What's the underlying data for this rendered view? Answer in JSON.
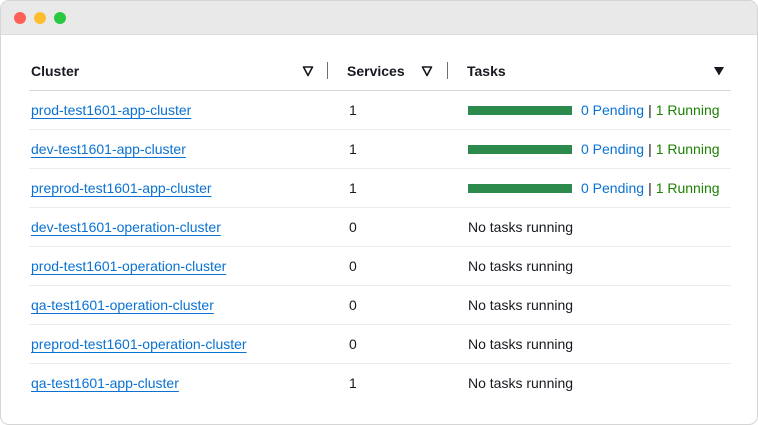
{
  "table": {
    "headers": {
      "cluster": "Cluster",
      "services": "Services",
      "tasks": "Tasks"
    },
    "sort_icons": {
      "cluster": "filter-triangle-outline-icon",
      "services": "filter-triangle-outline-icon",
      "tasks": "caret-down-filled-icon"
    },
    "rows": [
      {
        "cluster": "prod-test1601-app-cluster",
        "services": "1",
        "bar": true,
        "pending": "0 Pending",
        "sep": "|",
        "running": "1 Running",
        "no_tasks": ""
      },
      {
        "cluster": "dev-test1601-app-cluster",
        "services": "1",
        "bar": true,
        "pending": "0 Pending",
        "sep": "|",
        "running": "1 Running",
        "no_tasks": ""
      },
      {
        "cluster": "preprod-test1601-app-cluster",
        "services": "1",
        "bar": true,
        "pending": "0 Pending",
        "sep": "|",
        "running": "1 Running",
        "no_tasks": ""
      },
      {
        "cluster": "dev-test1601-operation-cluster",
        "services": "0",
        "bar": false,
        "pending": "",
        "sep": "",
        "running": "",
        "no_tasks": "No tasks running"
      },
      {
        "cluster": "prod-test1601-operation-cluster",
        "services": "0",
        "bar": false,
        "pending": "",
        "sep": "",
        "running": "",
        "no_tasks": "No tasks running"
      },
      {
        "cluster": "qa-test1601-operation-cluster",
        "services": "0",
        "bar": false,
        "pending": "",
        "sep": "",
        "running": "",
        "no_tasks": "No tasks running"
      },
      {
        "cluster": "preprod-test1601-operation-cluster",
        "services": "0",
        "bar": false,
        "pending": "",
        "sep": "",
        "running": "",
        "no_tasks": "No tasks running"
      },
      {
        "cluster": "qa-test1601-app-cluster",
        "services": "1",
        "bar": false,
        "pending": "",
        "sep": "",
        "running": "",
        "no_tasks": "No tasks running"
      }
    ]
  },
  "colors": {
    "link": "#0972d3",
    "running": "#1d8102",
    "bar": "#2c8a4c"
  }
}
